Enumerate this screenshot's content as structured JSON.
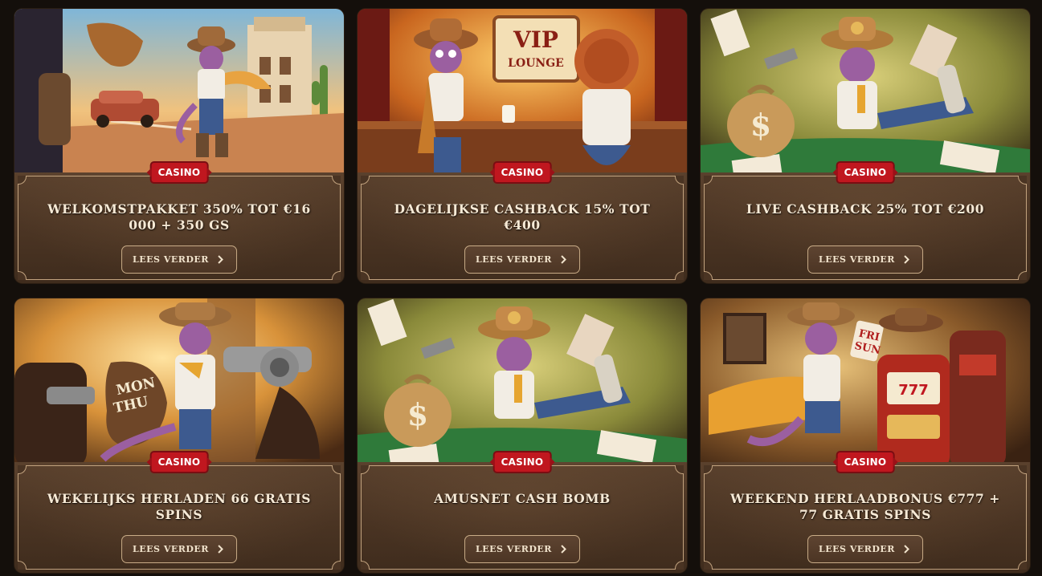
{
  "promotions": [
    {
      "badge": "CASINO",
      "title": "WELKOMSTPAKKET 350% TOT €16 000 + 350 GS",
      "button": "LEES VERDER",
      "scene": "desert-town"
    },
    {
      "badge": "CASINO",
      "title": "DAGELIJKSE CASHBACK 15% TOT €400",
      "button": "LEES VERDER",
      "scene": "vip-lounge"
    },
    {
      "badge": "CASINO",
      "title": "LIVE CASHBACK 25% TOT €200",
      "button": "LEES VERDER",
      "scene": "poker-table"
    },
    {
      "badge": "CASINO",
      "title": "WEKELIJKS HERLADEN 66 GRATIS SPINS",
      "button": "LEES VERDER",
      "scene": "mon-thu-sack"
    },
    {
      "badge": "CASINO",
      "title": "AMUSNET CASH BOMB",
      "button": "LEES VERDER",
      "scene": "poker-table"
    },
    {
      "badge": "CASINO",
      "title": "WEEKEND HERLAADBONUS €777 + 77 GRATIS SPINS",
      "button": "LEES VERDER",
      "scene": "slot-machine"
    }
  ],
  "art_labels": {
    "vip_sign": "VIP LOUNGE",
    "sack_text": "MON THU",
    "card_text": "FRI SUN",
    "dollar": "$"
  },
  "colors": {
    "badge_red": "#c0171f",
    "panel_brown": "#4a3423",
    "frame_tan": "#c2a37f",
    "title_cream": "#f7ead6",
    "page_bg": "#140f0b"
  },
  "icons": {
    "button_icon": "chevron-right-icon"
  }
}
